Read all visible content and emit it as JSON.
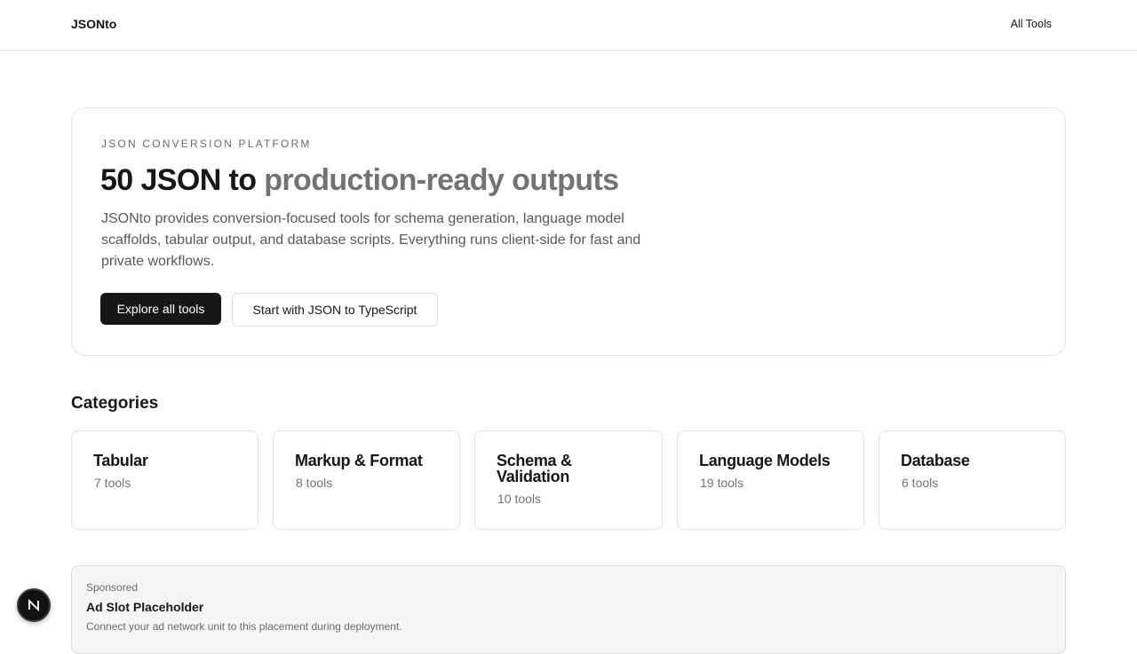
{
  "header": {
    "brand": "JSONto",
    "nav_all_tools": "All Tools"
  },
  "hero": {
    "eyebrow": "JSON CONVERSION PLATFORM",
    "title_strong": "50 JSON to",
    "title_muted": "production-ready outputs",
    "lead": "JSONto provides conversion-focused tools for schema generation, language model scaffolds, tabular output, and database scripts. Everything runs client-side for fast and private workflows.",
    "primary_button": "Explore all tools",
    "secondary_button": "Start with JSON to TypeScript"
  },
  "categories": {
    "title": "Categories",
    "items": [
      {
        "name": "Tabular",
        "count": "7 tools"
      },
      {
        "name": "Markup & Format",
        "count": "8 tools"
      },
      {
        "name": "Schema & Validation",
        "count": "10 tools"
      },
      {
        "name": "Language Models",
        "count": "19 tools"
      },
      {
        "name": "Database",
        "count": "6 tools"
      }
    ]
  },
  "ad": {
    "label": "Sponsored",
    "title": "Ad Slot Placeholder",
    "description": "Connect your ad network unit to this placement during deployment."
  },
  "dev_badge": {
    "icon": "nextjs-n-icon",
    "letter": "N"
  },
  "colors": {
    "text": "#171717",
    "muted": "#737373",
    "border": "#e5e5e5",
    "primary_button": "#171717",
    "ad_background": "#f5f5f5"
  }
}
